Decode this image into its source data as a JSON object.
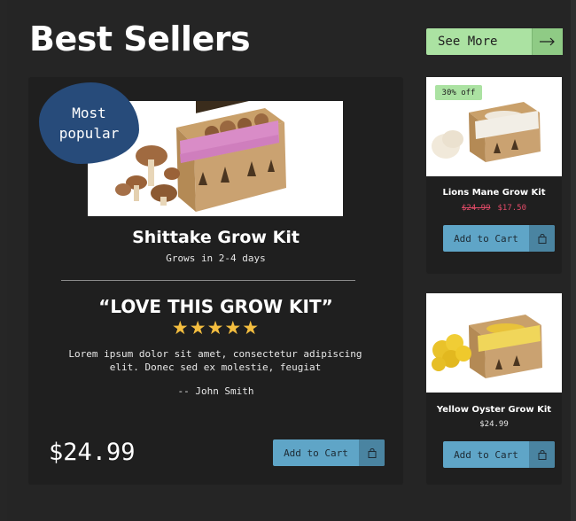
{
  "header": {
    "title": "Best Sellers",
    "see_more_label": "See More"
  },
  "featured": {
    "badge_line1": "Most",
    "badge_line2": "popular",
    "name": "Shittake Grow Kit",
    "subtitle": "Grows in 2-4 days",
    "review_title": "“LOVE THIS GROW KIT”",
    "stars": "★★★★★",
    "rating": 5,
    "review_body": "Lorem ipsum dolor sit amet, consectetur adipiscing elit. Donec sed ex molestie, feugiat",
    "review_author": "-- John Smith",
    "price": "$24.99",
    "add_to_cart_label": "Add to Cart"
  },
  "side_products": [
    {
      "badge": "30% off",
      "name": "Lions Mane Grow Kit",
      "old_price": "$24.99",
      "price": "$17.50",
      "add_to_cart_label": "Add to Cart"
    },
    {
      "name": "Yellow Oyster Grow Kit",
      "price": "$24.99",
      "add_to_cart_label": "Add to Cart"
    }
  ],
  "icons": {
    "arrow": "arrow-right-icon",
    "bag": "shopping-bag-icon",
    "star": "star-icon"
  },
  "colors": {
    "background": "#252525",
    "card": "#1f1f1f",
    "accent_green": "#abe2a2",
    "cart_blue": "#5fa5c7",
    "badge_blue": "#274b7a",
    "star_yellow": "#f3bd3f",
    "sale_red": "#e04a67"
  }
}
